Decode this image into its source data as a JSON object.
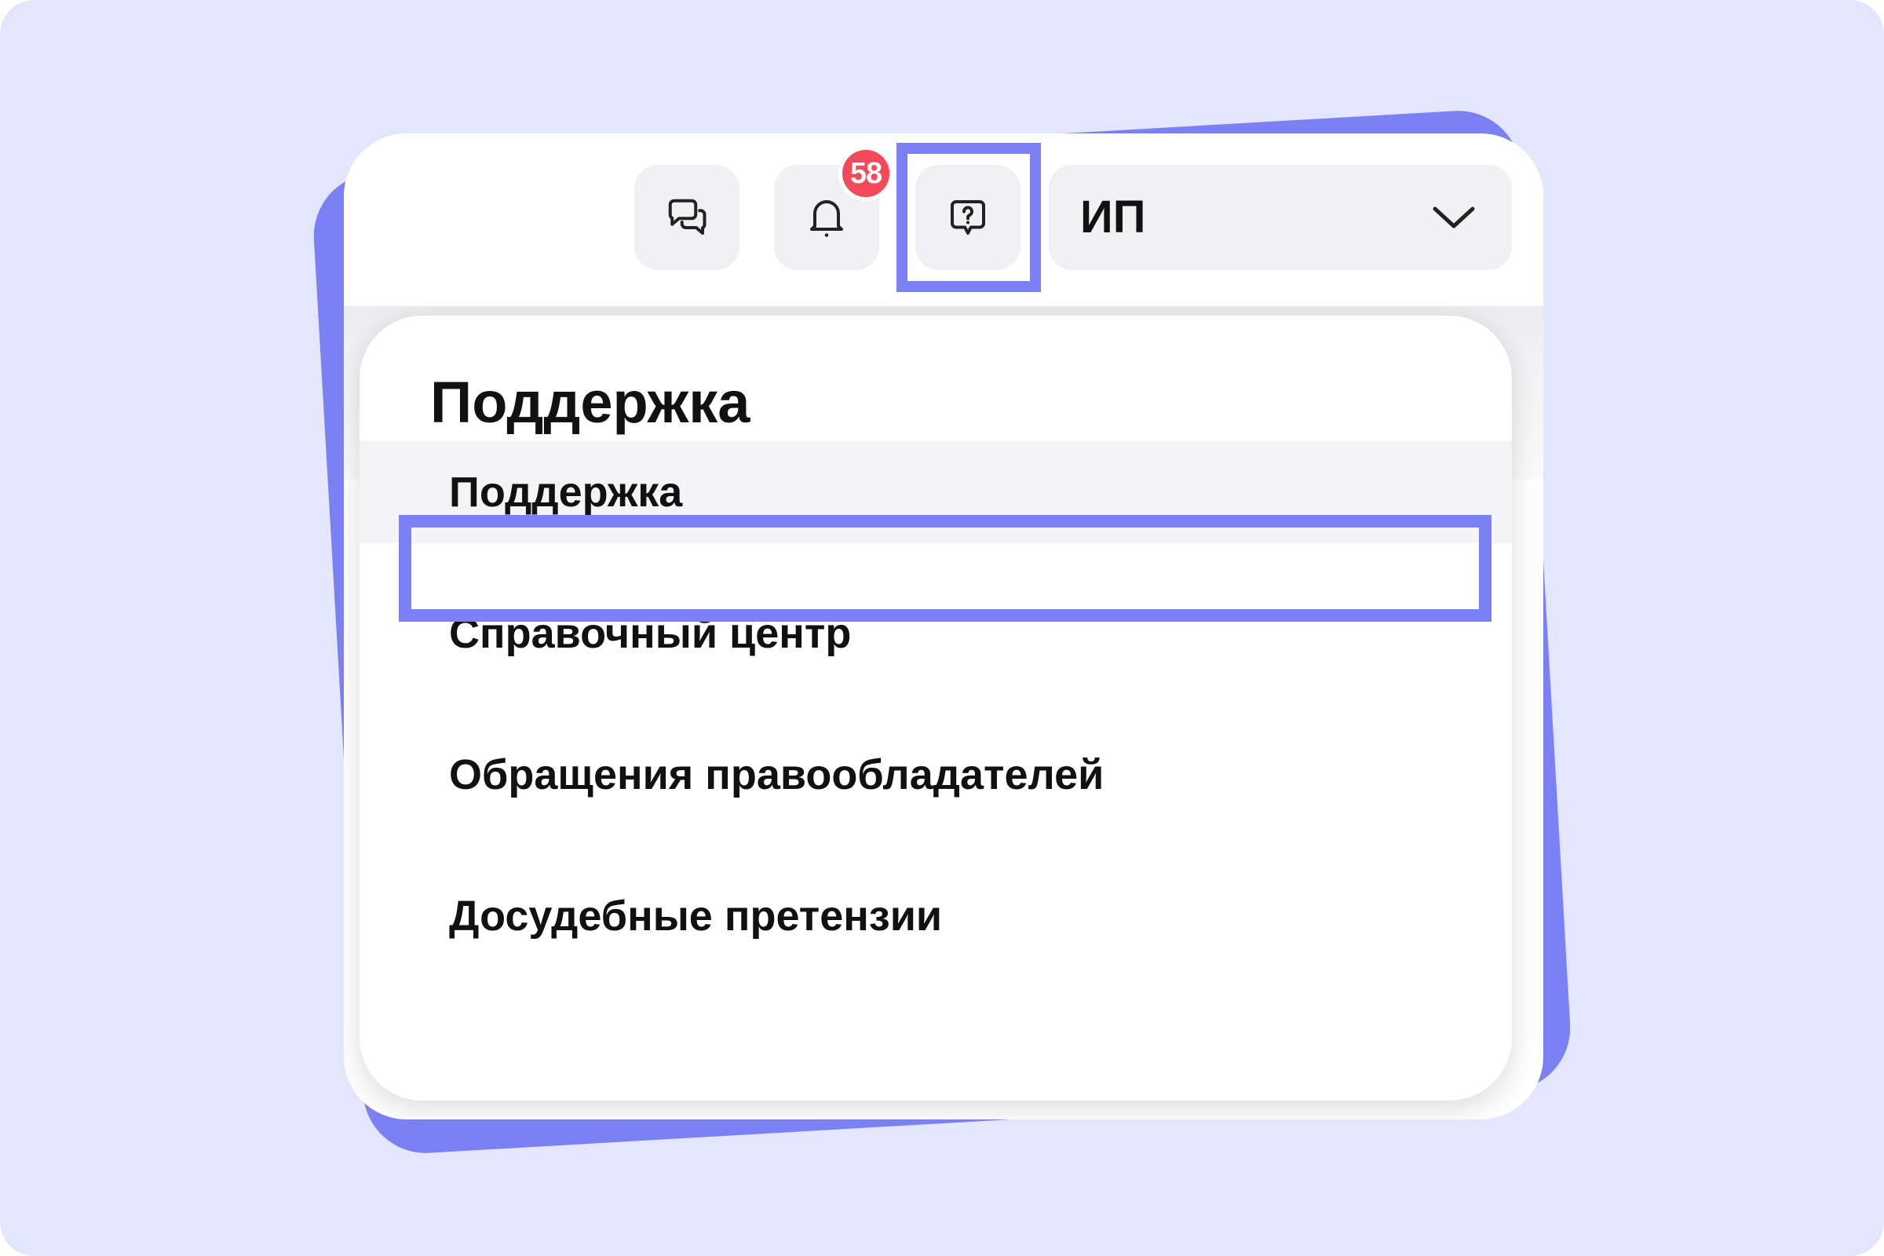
{
  "colors": {
    "page_background": "#e3e6fc",
    "accent": "#7b80f4",
    "card": "#ffffff",
    "icon_button": "#f1f1f3",
    "badge": "#f4495b",
    "text": "#111111"
  },
  "header": {
    "buttons": [
      {
        "icon": "chat-icon"
      },
      {
        "icon": "bell-icon",
        "badge": "58"
      },
      {
        "icon": "help-chat-icon",
        "highlighted": true
      }
    ],
    "account": {
      "label": "ИП",
      "icon": "chevron-down-icon"
    }
  },
  "dropdown": {
    "title": "Поддержка",
    "items": [
      {
        "label": "Поддержка",
        "highlighted": true
      },
      {
        "label": "Справочный центр"
      },
      {
        "label": "Обращения правообладателей"
      },
      {
        "label": "Досудебные претензии"
      }
    ]
  }
}
